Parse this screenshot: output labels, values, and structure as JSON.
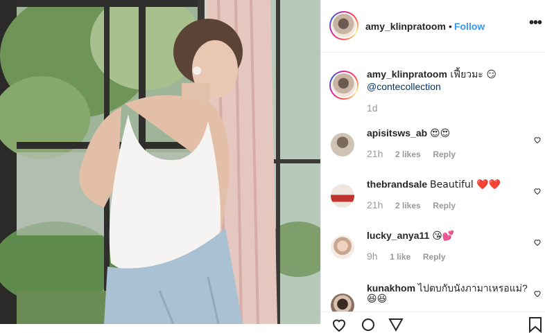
{
  "post": {
    "username": "amy_klinpratoom",
    "separator": "•",
    "follow_label": "Follow",
    "more_label": "•••"
  },
  "caption": {
    "username": "amy_klinpratoom",
    "text": "เฟี้ยวมะ 😏",
    "mention": "@contecollection",
    "time": "1d"
  },
  "comments": [
    {
      "username": "apisitsws_ab",
      "text": "😍😍",
      "time": "21h",
      "likes": "2 likes",
      "reply": "Reply"
    },
    {
      "username": "thebrandsale",
      "text": "Beautiful ❤️❤️",
      "time": "21h",
      "likes": "2 likes",
      "reply": "Reply"
    },
    {
      "username": "lucky_anya11",
      "text": "😘💕",
      "time": "9h",
      "likes": "1 like",
      "reply": "Reply"
    },
    {
      "username": "kunakhom",
      "text": "ไปตบกับนังภามาเหรอแม่?",
      "text2": "😆😆",
      "time": "",
      "likes": "",
      "reply": ""
    }
  ],
  "icons": {
    "like": "heart-icon",
    "comment": "comment-icon",
    "share": "share-icon",
    "save": "bookmark-icon"
  },
  "colors": {
    "follow": "#3897f0",
    "mention": "#003569",
    "muted": "#999999",
    "heart": "#ed4956"
  }
}
